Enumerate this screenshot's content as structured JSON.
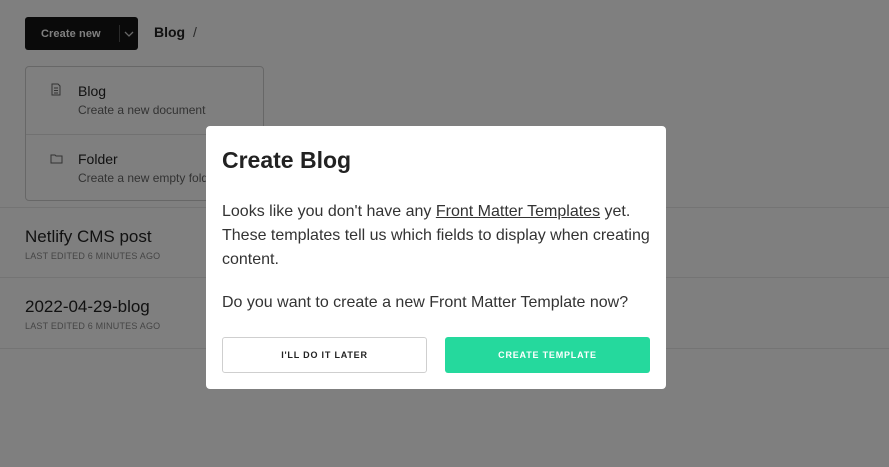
{
  "toolbar": {
    "create_new_label": "Create new",
    "breadcrumb": "Blog",
    "breadcrumb_separator": "/"
  },
  "menu": {
    "items": [
      {
        "title": "Blog",
        "subtitle": "Create a new document",
        "icon": "document-icon"
      },
      {
        "title": "Folder",
        "subtitle": "Create a new empty folder",
        "icon": "folder-icon"
      }
    ]
  },
  "entries": [
    {
      "title": "Netlify CMS post",
      "meta": "LAST EDITED 6 MINUTES AGO"
    },
    {
      "title": "2022-04-29-blog",
      "meta": "LAST EDITED 6 MINUTES AGO"
    }
  ],
  "dialog": {
    "title": "Create Blog",
    "body_prefix": "Looks like you don't have any ",
    "body_link": "Front Matter Templates",
    "body_suffix": " yet. These templates tell us which fields to display when creating content.",
    "question": "Do you want to create a new Front Matter Template now?",
    "later_label": "I'LL DO IT LATER",
    "create_label": "CREATE TEMPLATE"
  },
  "colors": {
    "accent": "#25d99d",
    "primary_button": "#141414",
    "overlay": "rgba(0,0,0,0.5)"
  }
}
